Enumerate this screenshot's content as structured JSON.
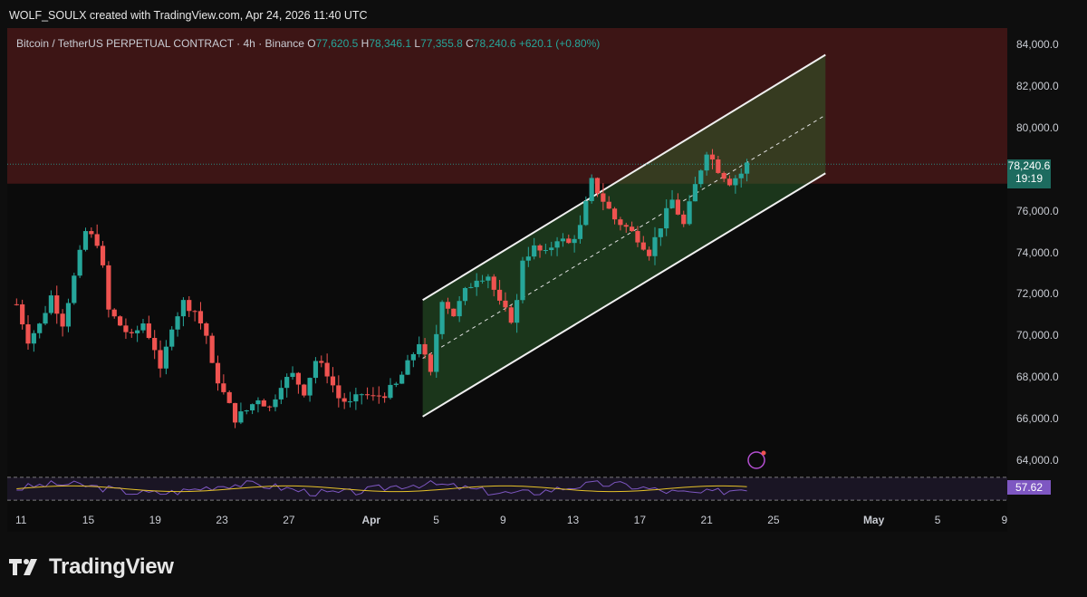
{
  "header": {
    "credit": "WOLF_SOULX created with TradingView.com, Apr 24, 2026 11:40 UTC"
  },
  "legend": {
    "symbol": "Bitcoin / TetherUS PERPETUAL CONTRACT · 4h · Binance",
    "open_label": "O",
    "open": "77,620.5",
    "high_label": "H",
    "high": "78,346.1",
    "low_label": "L",
    "low": "77,355.8",
    "close_label": "C",
    "close": "78,240.6",
    "change": "+620.1 (+0.80%)"
  },
  "price_badge": {
    "price": "78,240.6",
    "countdown": "19:19"
  },
  "rsi_badge": {
    "value": "57.62"
  },
  "footer": {
    "brand": "TradingView"
  },
  "colors": {
    "up": "#26a69a",
    "down": "#ef5350",
    "zone": "#4a1a1a",
    "channel_fill": "#1f4a1f",
    "rsi": "#7e57c2",
    "rsi_ma": "#e6c229",
    "badge_price": "#1d6b5f",
    "badge_rsi": "#7e57c2"
  },
  "chart_data": {
    "type": "candlestick",
    "x_ticks": [
      "11",
      "15",
      "19",
      "23",
      "27",
      "Apr",
      "5",
      "9",
      "13",
      "17",
      "21",
      "25",
      "May",
      "5",
      "9"
    ],
    "y_ticks": [
      "84,000.0",
      "82,000.0",
      "80,000.0",
      "76,000.0",
      "74,000.0",
      "72,000.0",
      "70,000.0",
      "68,000.0",
      "66,000.0",
      "64,000.0"
    ],
    "ylim": [
      63000,
      85000
    ],
    "resistance_zone": [
      77300,
      85000
    ],
    "channel": {
      "lower": {
        "start": [
          "Apr 4",
          66100
        ],
        "end": [
          "Apr 28",
          77800
        ]
      },
      "upper": {
        "start": [
          "Apr 4",
          71700
        ],
        "end": [
          "Apr 28",
          83500
        ]
      },
      "mid": {
        "start": [
          "Apr 4",
          68900
        ],
        "end": [
          "Apr 28",
          80600
        ]
      }
    },
    "price_path": [
      [
        0,
        71500
      ],
      [
        2,
        69800
      ],
      [
        4,
        70500
      ],
      [
        6,
        71900
      ],
      [
        8,
        70600
      ],
      [
        10,
        72800
      ],
      [
        11,
        73900
      ],
      [
        12,
        75000
      ],
      [
        14,
        74500
      ],
      [
        15,
        73200
      ],
      [
        16,
        71200
      ],
      [
        18,
        70500
      ],
      [
        20,
        69900
      ],
      [
        22,
        70600
      ],
      [
        24,
        69400
      ],
      [
        25,
        68200
      ],
      [
        27,
        70500
      ],
      [
        29,
        71600
      ],
      [
        31,
        71200
      ],
      [
        33,
        70000
      ],
      [
        34,
        68500
      ],
      [
        36,
        67200
      ],
      [
        38,
        66000
      ],
      [
        40,
        66400
      ],
      [
        42,
        67000
      ],
      [
        44,
        66500
      ],
      [
        46,
        67700
      ],
      [
        48,
        68100
      ],
      [
        50,
        67300
      ],
      [
        52,
        68800
      ],
      [
        54,
        68200
      ],
      [
        56,
        67000
      ],
      [
        58,
        66700
      ],
      [
        60,
        67200
      ],
      [
        62,
        67000
      ],
      [
        64,
        67200
      ],
      [
        66,
        67600
      ],
      [
        68,
        68600
      ],
      [
        70,
        69700
      ],
      [
        71,
        68900
      ],
      [
        72,
        68100
      ],
      [
        73,
        70100
      ],
      [
        74,
        71800
      ],
      [
        76,
        71000
      ],
      [
        78,
        72100
      ],
      [
        80,
        72800
      ],
      [
        82,
        72900
      ],
      [
        84,
        71500
      ],
      [
        86,
        70800
      ],
      [
        87,
        71600
      ],
      [
        88,
        73700
      ],
      [
        90,
        74200
      ],
      [
        92,
        73900
      ],
      [
        94,
        74700
      ],
      [
        96,
        74400
      ],
      [
        98,
        75200
      ],
      [
        100,
        77400
      ],
      [
        102,
        76500
      ],
      [
        104,
        75600
      ],
      [
        106,
        75200
      ],
      [
        108,
        74700
      ],
      [
        110,
        74000
      ],
      [
        112,
        75300
      ],
      [
        114,
        76500
      ],
      [
        116,
        75300
      ],
      [
        118,
        77200
      ],
      [
        120,
        78900
      ],
      [
        122,
        78000
      ],
      [
        124,
        77400
      ],
      [
        126,
        77800
      ],
      [
        127,
        78240
      ]
    ],
    "rsi": {
      "last": 57.62,
      "upper_band": 70,
      "lower_band": 30
    }
  }
}
